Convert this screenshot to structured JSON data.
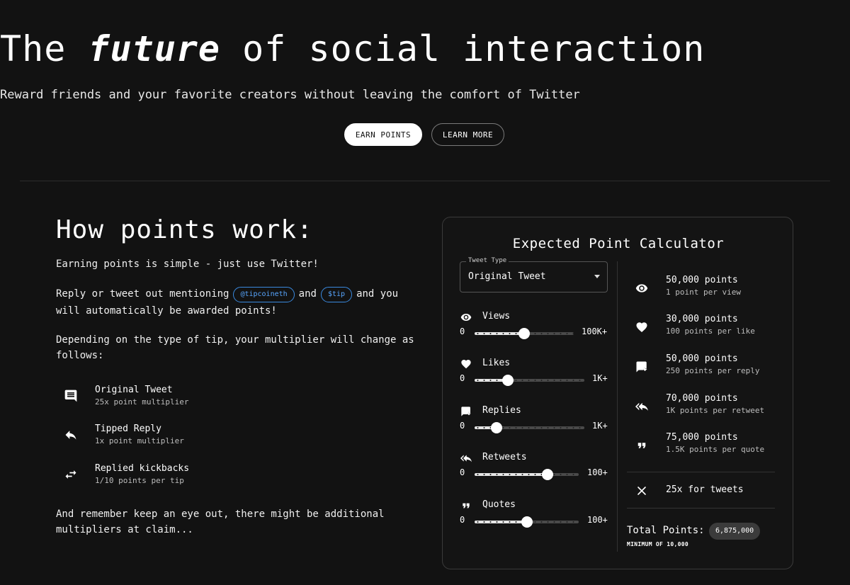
{
  "hero": {
    "title_prefix": "The",
    "title_emphasis": "future",
    "title_suffix": "of social interaction",
    "subtitle": "Reward friends and your favorite creators without leaving the comfort of Twitter",
    "earn_button": "EARN POINTS",
    "learn_button": "LEARN MORE"
  },
  "how": {
    "title": "How points work:",
    "p1": "Earning points is simple - just use Twitter!",
    "p2_a": "Reply or tweet out mentioning",
    "tag1": "@tipcoineth",
    "p2_b": "and",
    "tag2": "$tip",
    "p2_c": "and you will automatically be awarded points!",
    "p3": "Depending on the type of tip, your multiplier will change as follows:",
    "items": [
      {
        "title": "Original Tweet",
        "desc": "25x point multiplier",
        "icon": "comment-icon"
      },
      {
        "title": "Tipped Reply",
        "desc": "1x point multiplier",
        "icon": "reply-icon"
      },
      {
        "title": "Replied kickbacks",
        "desc": "1/10 points per tip",
        "icon": "swap-icon"
      }
    ],
    "p4": "And remember keep an eye out, there might be additional multipliers at claim..."
  },
  "calculator": {
    "title": "Expected Point Calculator",
    "tweet_type_label": "Tweet Type",
    "tweet_type_value": "Original Tweet",
    "sliders": [
      {
        "label": "Views",
        "min": "0",
        "max": "100K+",
        "level": 0.5,
        "icon": "eye-icon"
      },
      {
        "label": "Likes",
        "min": "0",
        "max": "1K+",
        "level": 0.3,
        "icon": "heart-icon"
      },
      {
        "label": "Replies",
        "min": "0",
        "max": "1K+",
        "level": 0.2,
        "icon": "reply-bubble-icon"
      },
      {
        "label": "Retweets",
        "min": "0",
        "max": "100+",
        "level": 0.7,
        "icon": "retweet-icon"
      },
      {
        "label": "Quotes",
        "min": "0",
        "max": "100+",
        "level": 0.5,
        "icon": "quote-icon"
      }
    ],
    "results": [
      {
        "points": "50,000 points",
        "rate": "1 point per view",
        "icon": "eye-icon"
      },
      {
        "points": "30,000 points",
        "rate": "100 points per like",
        "icon": "heart-icon"
      },
      {
        "points": "50,000 points",
        "rate": "250 points per reply",
        "icon": "reply-bubble-icon"
      },
      {
        "points": "70,000 points",
        "rate": "1K points per retweet",
        "icon": "retweet-icon"
      },
      {
        "points": "75,000 points",
        "rate": "1.5K points per quote",
        "icon": "quote-icon"
      }
    ],
    "multiplier": "25x for tweets",
    "total_label": "Total Points:",
    "total_value": "6,875,000",
    "minimum": "MINIMUM OF 10,000"
  }
}
